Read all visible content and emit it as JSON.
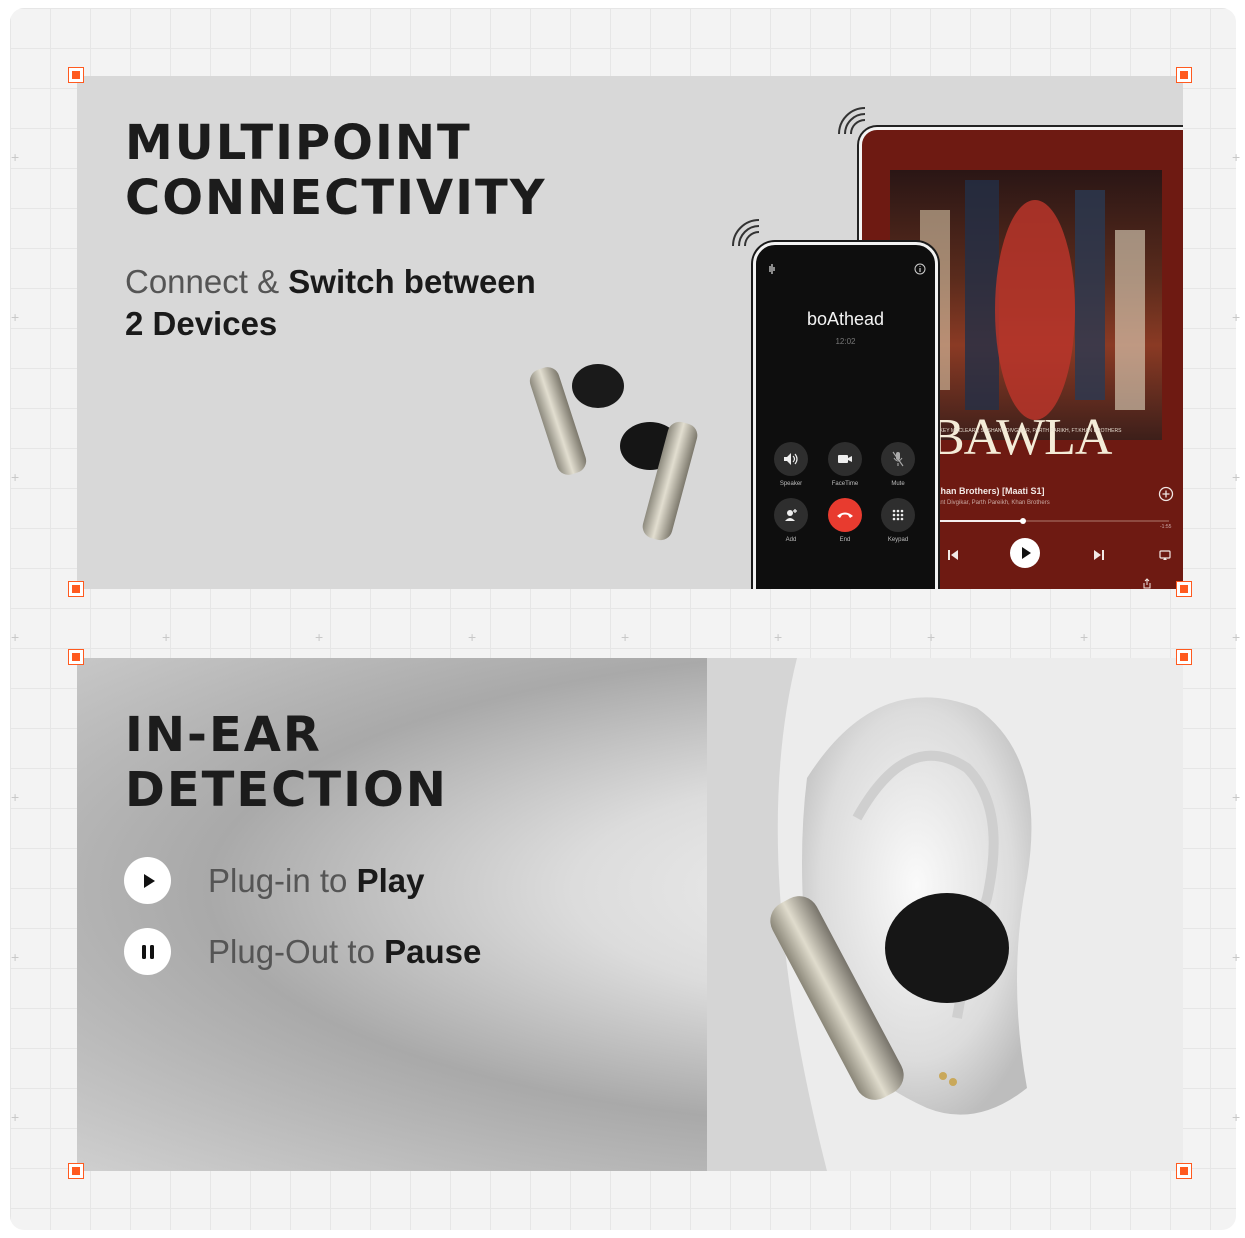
{
  "multipoint": {
    "title_line1": "MULTIPOINT",
    "title_line2": "CONNECTIVITY",
    "sub_light": "Connect &",
    "sub_bold1": "Switch between",
    "sub_bold2": "2 Devices"
  },
  "phone": {
    "caller": "boAthead",
    "time": "12:02",
    "buttons": {
      "speaker": "Speaker",
      "facetime": "FaceTime",
      "mute": "Mute",
      "add": "Add",
      "end": "End",
      "keypad": "Keypad"
    }
  },
  "tablet": {
    "album_title": "BAWLA",
    "album_credits": "MIKEY MCCLEARY, SUSHANT DIVGIKAR, PARTH PARIKH, FT.KHAN BROTHERS",
    "track": "Khan Brothers) [Maati S1]",
    "artist": "sant Divgikar, Parth Pareikh, Khan Brothers",
    "remaining": "-1:55",
    "progress": 0.38
  },
  "inear": {
    "title_line1": "IN-EAR",
    "title_line2": "DETECTION",
    "play_light": "Plug-in to",
    "play_bold": "Play",
    "pause_light": "Plug-Out to",
    "pause_bold": "Pause"
  },
  "colors": {
    "accent": "#ff5a1f",
    "end_call": "#e83b2f"
  }
}
